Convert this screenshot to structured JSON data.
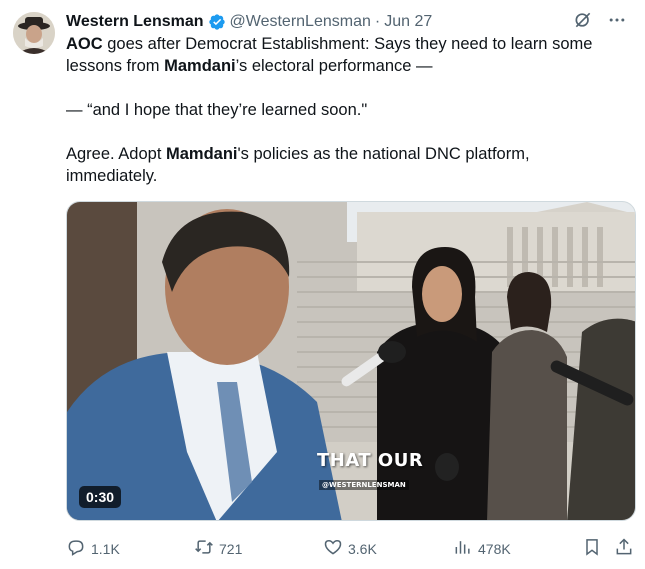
{
  "tweet": {
    "author_name": "Western Lensman",
    "handle": "@WesternLensman",
    "separator": "·",
    "date": "Jun 27",
    "lines": [
      {
        "bold": "AOC",
        "rest": " goes after Democrat Establishment: Says they need to learn some"
      },
      {
        "pre": "lessons from ",
        "bold": "Mamdani",
        "rest": "’s electoral performance —"
      },
      {
        "text": "— “and I hope that they’re learned soon.\""
      },
      {
        "pre": "Agree. Adopt ",
        "bold": "Mamdani",
        "rest": "'s policies as the national DNC platform,"
      },
      {
        "text": "immediately."
      }
    ]
  },
  "media": {
    "duration": "0:30",
    "caption": "THAT OUR",
    "watermark": "@WESTERNLENSMAN"
  },
  "actions": {
    "reply_count": "1.1K",
    "retweet_count": "721",
    "like_count": "3.6K",
    "views_count": "478K"
  },
  "icons": {
    "verified": "verified-badge-icon",
    "grok": "grok-icon",
    "more": "more-icon",
    "reply": "reply-icon",
    "retweet": "retweet-icon",
    "like": "heart-icon",
    "views": "views-icon",
    "bookmark": "bookmark-icon",
    "share": "share-icon"
  },
  "colors": {
    "verified": "#1d9bf0",
    "muted": "#536471",
    "text": "#0f1419"
  }
}
